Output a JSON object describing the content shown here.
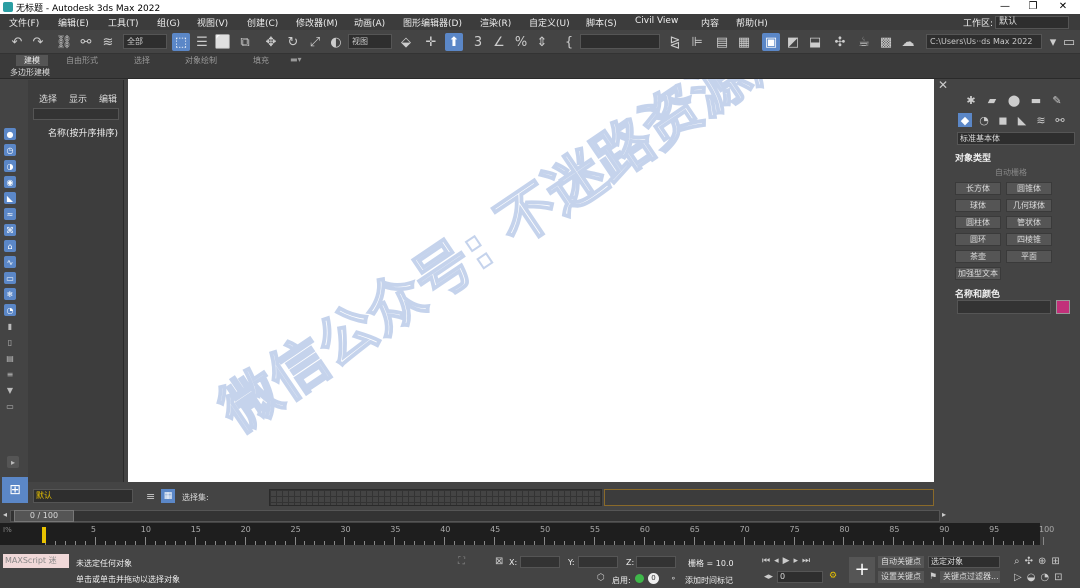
{
  "window": {
    "title": "无标题 - Autodesk 3ds Max 2022",
    "minimize": "—",
    "maximize": "❐",
    "close": "✕"
  },
  "menu": [
    "文件(F)",
    "编辑(E)",
    "工具(T)",
    "组(G)",
    "视图(V)",
    "创建(C)",
    "修改器(M)",
    "动画(A)",
    "图形编辑器(D)",
    "渲染(R)",
    "自定义(U)",
    "脚本(S)",
    "Civil View",
    "内容",
    "帮助(H)"
  ],
  "workspace": {
    "label": "工作区:",
    "value": "默认"
  },
  "toolbar": {
    "selection_filter": "全部",
    "ref_coord": "视图",
    "path_field": "C:\\Users\\Us··ds Max 2022"
  },
  "ribbon": {
    "tabs": [
      "建模",
      "自由形式",
      "选择",
      "对象绘制",
      "填充"
    ],
    "active": "建模",
    "subpanel": "多边形建模"
  },
  "scene_explorer": {
    "tabs": [
      "选择",
      "显示",
      "编辑"
    ],
    "column": "名称(按升序排序)"
  },
  "command_panel": {
    "category": "标准基本体",
    "object_type_header": "对象类型",
    "autogrid": "自动栅格",
    "buttons": [
      "长方体",
      "圆锥体",
      "球体",
      "几何球体",
      "圆柱体",
      "管状体",
      "圆环",
      "四棱锥",
      "茶壶",
      "平面",
      "加强型文本"
    ],
    "name_color_header": "名称和颜色",
    "color": "#c2307a"
  },
  "bottom": {
    "layer": "默认",
    "selection_set_label": "选择集:",
    "time_position": "0 / 100",
    "ruler_labels": [
      "5",
      "10",
      "15",
      "20",
      "25",
      "30",
      "35",
      "40",
      "45",
      "50",
      "55",
      "60",
      "65",
      "70",
      "75",
      "80",
      "85",
      "90",
      "95",
      "100"
    ],
    "maxscript": "MAXScript 迷",
    "status1": "未选定任何对象",
    "status2": "单击或单击并拖动以选择对象",
    "x_label": "X:",
    "y_label": "Y:",
    "z_label": "Z:",
    "grid": "栅格 = 10.0",
    "enable": "启用:",
    "add_time_tag": "添加时间标记",
    "auto_key": "自动关键点",
    "set_key": "设置关键点",
    "key_filter_select": "选定对象",
    "key_filters": "关键点过滤器...",
    "frame": "0"
  },
  "watermark": "微信公众号: 不迷路资源库"
}
